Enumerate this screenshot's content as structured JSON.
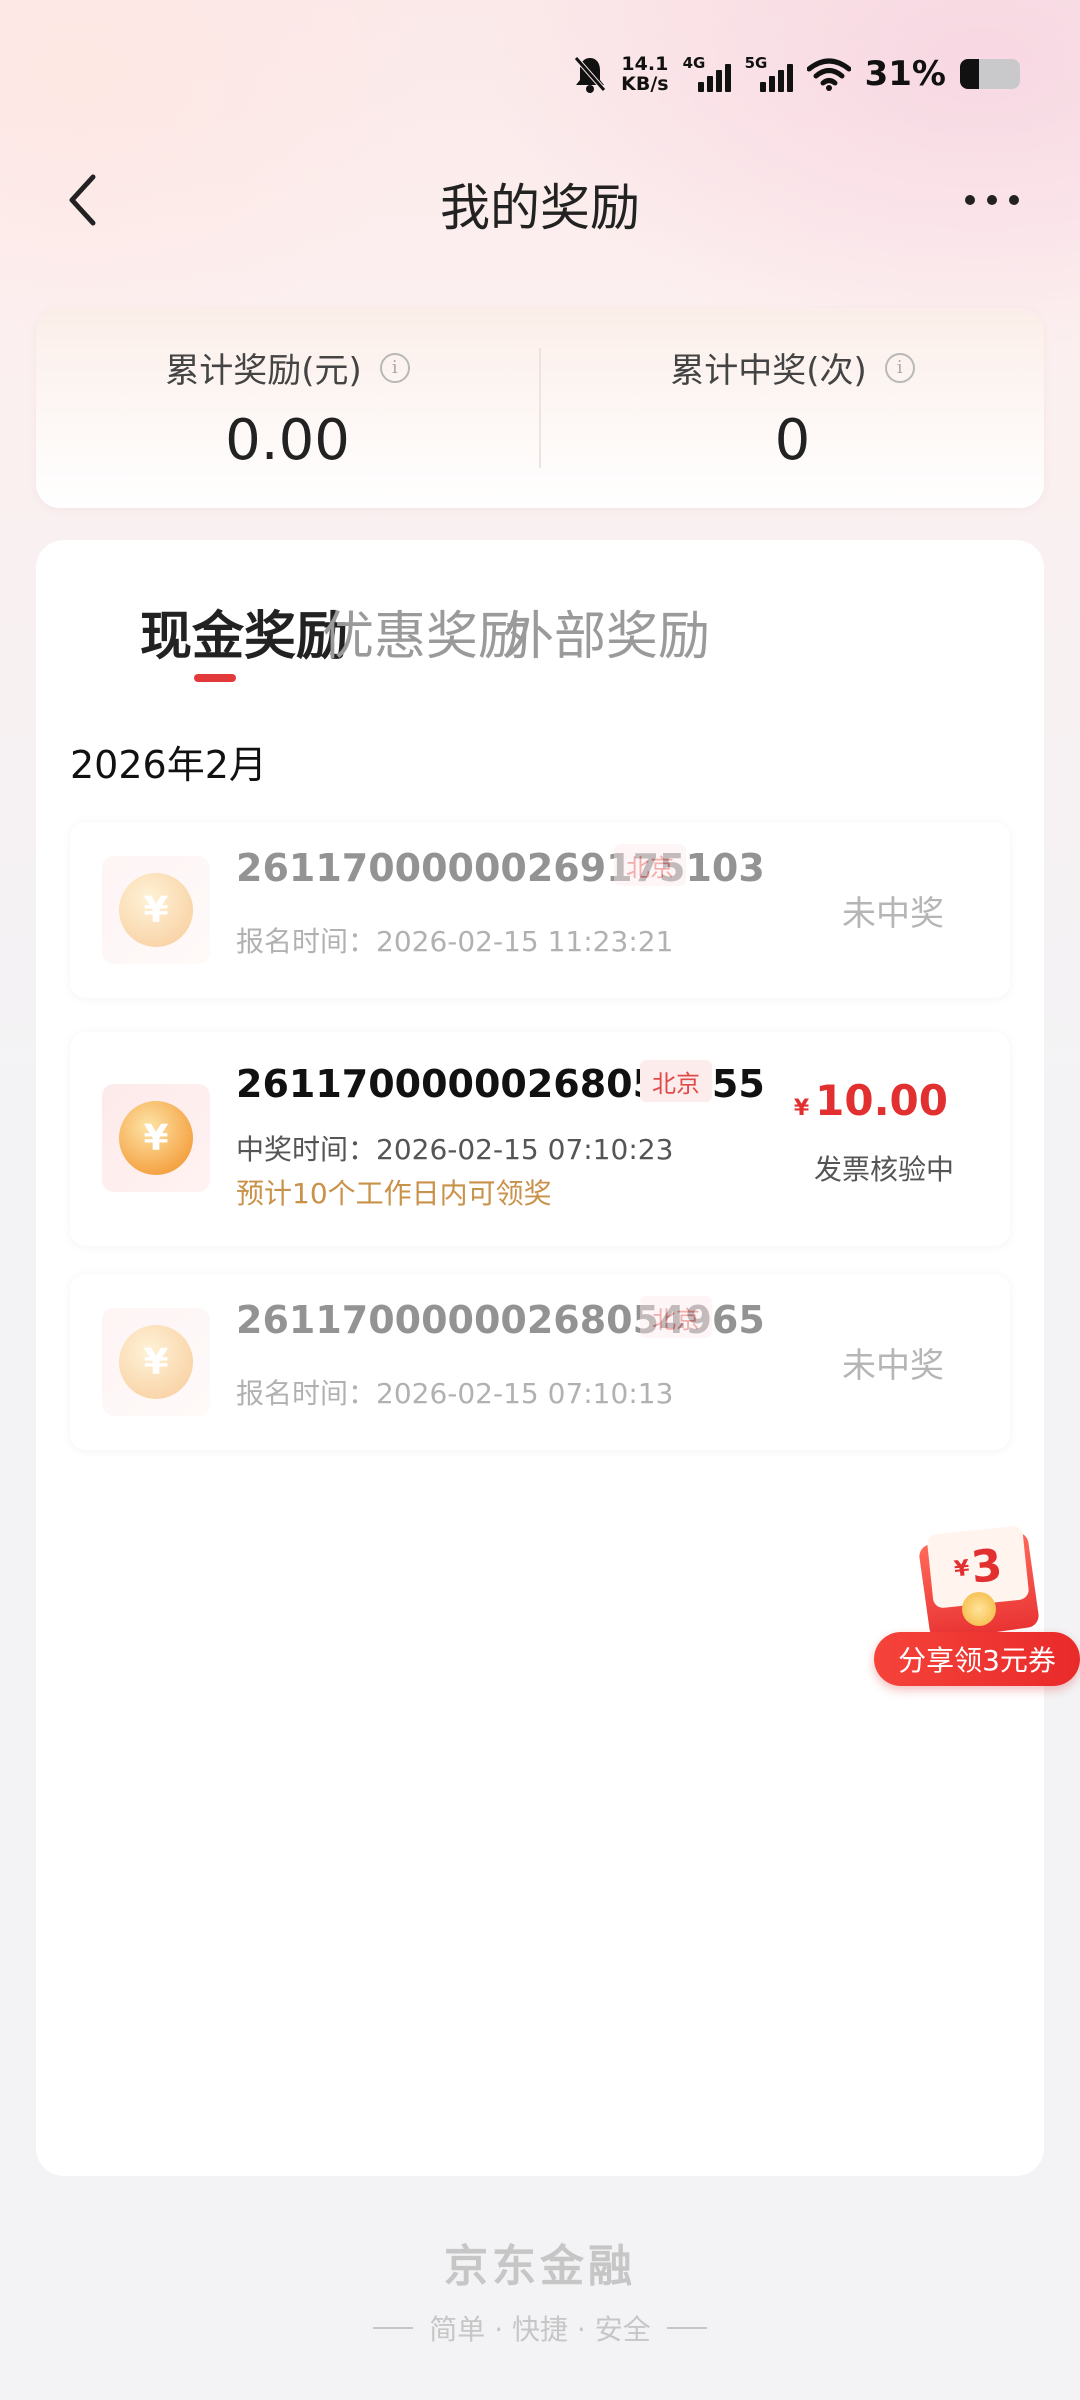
{
  "status_bar": {
    "speed_value": "14.1",
    "speed_unit": "KB/s",
    "sim1_tag": "4G",
    "sim2_tag": "5G",
    "battery_percent_text": "31%",
    "battery_level": 0.31
  },
  "header": {
    "title": "我的奖励"
  },
  "summary": {
    "total_reward_label": "累计奖励(元)",
    "total_reward_value": "0.00",
    "total_wins_label": "累计中奖(次)",
    "total_wins_value": "0"
  },
  "tabs": [
    {
      "label": "现金奖励",
      "active": true
    },
    {
      "label": "优惠奖励",
      "active": false
    },
    {
      "label": "外部奖励",
      "active": false
    }
  ],
  "month": "2026年2月",
  "records": [
    {
      "id": "26117000000269175103",
      "city": "北京",
      "time": "报名时间：2026-02-15 11:23:21",
      "status": "未中奖"
    },
    {
      "id": "26117000000268054455",
      "city": "北京",
      "time": "中奖时间：2026-02-15 07:10:23",
      "note": "预计10个工作日内可领奖",
      "currency": "¥",
      "amount": "10.00",
      "status": "发票核验中"
    },
    {
      "id": "26117000000268054965",
      "city": "北京",
      "time": "报名时间：2026-02-15 07:10:13",
      "status": "未中奖"
    }
  ],
  "coin_symbol": "¥",
  "promo": {
    "card_currency": "¥",
    "card_number": "3",
    "label": "分享领3元券"
  },
  "footer": {
    "brand": "京东金融",
    "slogan": "简单 · 快捷 · 安全"
  },
  "colors": {
    "accent_red": "#e23030",
    "note_gold": "#c9924a"
  }
}
